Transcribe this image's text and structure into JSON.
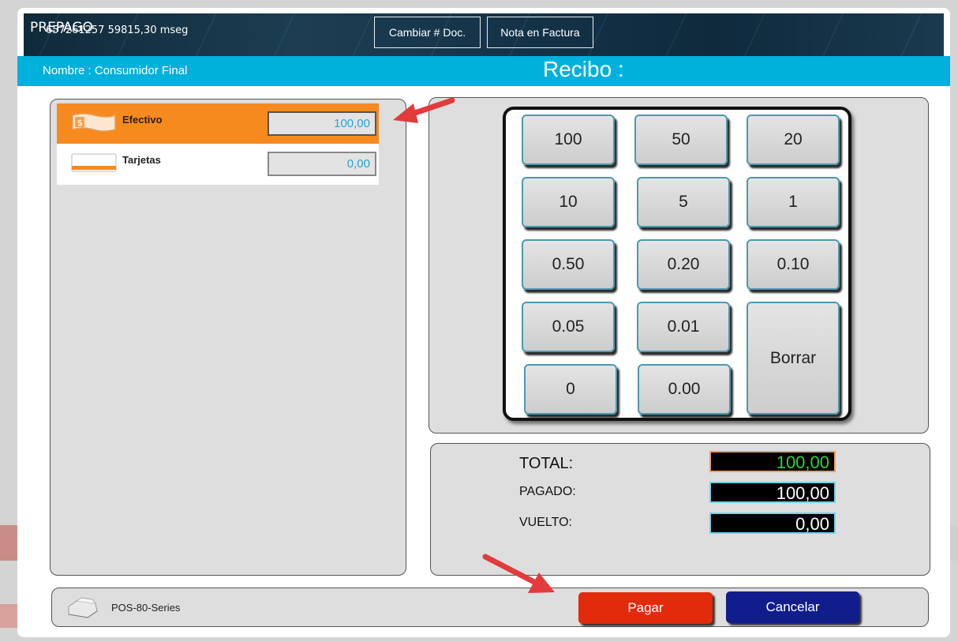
{
  "header": {
    "brand": "PREPAGO",
    "timer": "657261257 59815,30 mseg",
    "change_doc_button": "Cambiar # Doc.",
    "invoice_note_button": "Nota en Factura"
  },
  "bar": {
    "client_label": "Nombre  :  Consumidor Final",
    "title": "Recibo :"
  },
  "payment_methods": [
    {
      "label": "Efectivo",
      "amount": "100,00",
      "icon": "cash-icon",
      "selected": true
    },
    {
      "label": "Tarjetas",
      "amount": "0,00",
      "icon": "card-icon",
      "selected": false
    }
  ],
  "keypad": {
    "keys": [
      "100",
      "50",
      "20",
      "10",
      "5",
      "1",
      "0.50",
      "0.20",
      "0.10",
      "0.05",
      "0.01",
      "0",
      "0.00"
    ],
    "clear_label": "Borrar"
  },
  "totals": {
    "total_label": "TOTAL:",
    "total_value": "100,00",
    "paid_label": "PAGADO:",
    "paid_value": "100,00",
    "change_label": "VUELTO:",
    "change_value": "0,00"
  },
  "footer": {
    "printer_name": "POS-80-Series",
    "pay_button": "Pagar",
    "cancel_button": "Cancelar"
  },
  "colors": {
    "accent_bar": "#00b1dc",
    "selected_method": "#f68a1f",
    "pay_button": "#e12b0a",
    "cancel_button": "#111d8c",
    "total_value": "#2fcf3f",
    "annotation_arrow": "#e23b3b"
  }
}
